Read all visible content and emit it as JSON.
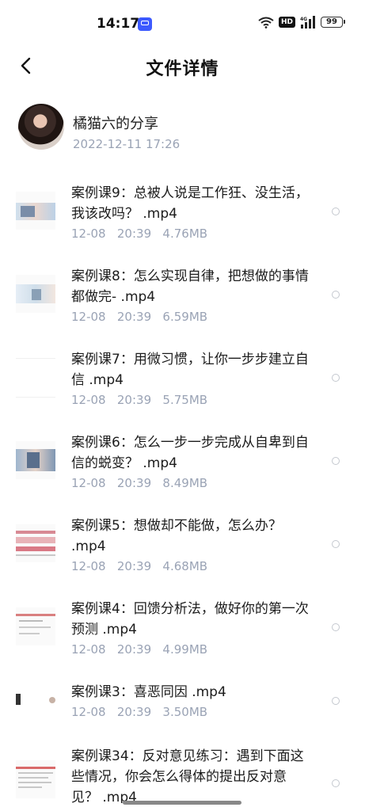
{
  "status_bar": {
    "time": "14:17",
    "app_icon": "screen-cast-icon",
    "icons": [
      "wifi-icon",
      "hd-icon",
      "signal-4g-icon",
      "battery-icon"
    ],
    "hd": "HD",
    "network": "4G",
    "battery": "99"
  },
  "header": {
    "back_icon": "chevron-left-icon",
    "title": "文件详情"
  },
  "sharer": {
    "name": "橘猫六的分享",
    "time": "2022-12-11   17:26"
  },
  "files": [
    {
      "name": "案例课9：总被人说是工作狂、没生活，我该改吗？ .mp4",
      "meta": "12-08   20:39   4.76MB"
    },
    {
      "name": "案例课8：怎么实现自律，把想做的事情都做完- .mp4",
      "meta": "12-08   20:39   6.59MB"
    },
    {
      "name": "案例课7：用微习惯，让你一步步建立自信 .mp4",
      "meta": "12-08   20:39   5.75MB"
    },
    {
      "name": "案例课6：怎么一步一步完成从自卑到自信的蜕变？ .mp4",
      "meta": "12-08   20:39   8.49MB"
    },
    {
      "name": "案例课5：想做却不能做，怎么办？ .mp4",
      "meta": "12-08   20:39   4.68MB"
    },
    {
      "name": "案例课4：回馈分析法，做好你的第一次预测 .mp4",
      "meta": "12-08   20:39   4.99MB"
    },
    {
      "name": "案例课3：喜恶同因 .mp4",
      "meta": "12-08   20:39   3.50MB"
    },
    {
      "name": "案例课34：反对意见练习：遇到下面这些情况，你会怎么得体的提出反对意见？ .mp4",
      "meta": ""
    }
  ],
  "colors": {
    "meta_text": "#9aa3b5",
    "title_text": "#111111",
    "radio_border": "#c4c8cf"
  }
}
